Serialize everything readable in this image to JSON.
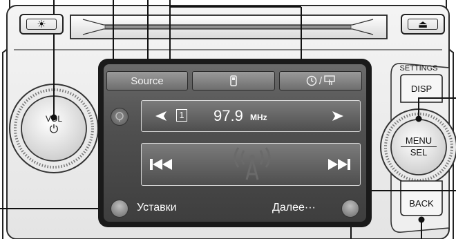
{
  "hardware": {
    "settings_label": "SETTINGS",
    "disp_label": "DISP",
    "menu_label": "MENU",
    "sel_label": "SEL",
    "back_label": "BACK",
    "vol_label": "VOL",
    "power_symbol": "⏻",
    "brightness_symbol": "☀",
    "eject_symbol": "⏏"
  },
  "screen": {
    "tab_source": "Source",
    "tab_phone_icon": "phone-icon",
    "tab_clock_separator": "/",
    "preset_number": "1",
    "frequency": "97.9",
    "frequency_unit": "MHz",
    "settings_label": "Уставки",
    "more_label": "Далее···"
  },
  "colors": {
    "callout_line": "#111111",
    "screen_bg": "#4e4e4e",
    "button_face": "#e8e8e8"
  }
}
